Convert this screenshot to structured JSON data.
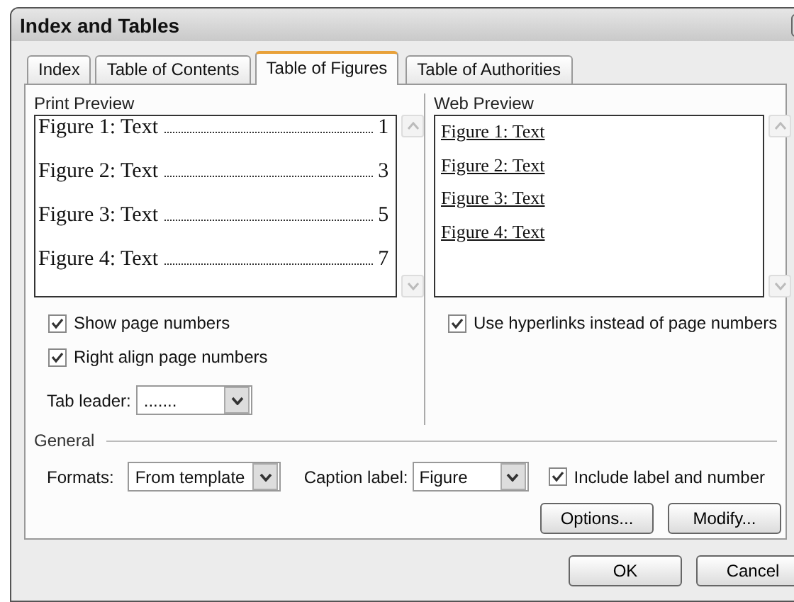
{
  "window": {
    "title": "Index and Tables"
  },
  "tabs": [
    {
      "label": "Index",
      "selected": false
    },
    {
      "label": "Table of Contents",
      "selected": false
    },
    {
      "label": "Table of Figures",
      "selected": true
    },
    {
      "label": "Table of Authorities",
      "selected": false
    }
  ],
  "print_preview": {
    "label": "Print Preview",
    "entries": [
      {
        "caption": "Figure 1: Text",
        "page": "1"
      },
      {
        "caption": "Figure 2: Text",
        "page": "3"
      },
      {
        "caption": "Figure 3: Text",
        "page": "5"
      },
      {
        "caption": "Figure 4: Text",
        "page": "7"
      }
    ]
  },
  "web_preview": {
    "label": "Web Preview",
    "entries": [
      "Figure 1: Text",
      "Figure 2: Text",
      "Figure 3: Text",
      "Figure 4: Text"
    ]
  },
  "print_options": [
    {
      "label": "Show page numbers",
      "checked": true
    },
    {
      "label": "Right align page numbers",
      "checked": true
    }
  ],
  "tab_leader": {
    "label": "Tab leader:",
    "value": "......."
  },
  "web_options": [
    {
      "label": "Use hyperlinks instead of page numbers",
      "checked": true
    }
  ],
  "general": {
    "label": "General",
    "formats": {
      "label": "Formats:",
      "value": "From template"
    },
    "caption_label": {
      "label": "Caption label:",
      "value": "Figure"
    },
    "include_label": {
      "label": "Include label and number",
      "checked": true
    }
  },
  "panel_buttons": [
    "Options...",
    "Modify..."
  ],
  "dialog_buttons": [
    "OK",
    "Cancel"
  ]
}
